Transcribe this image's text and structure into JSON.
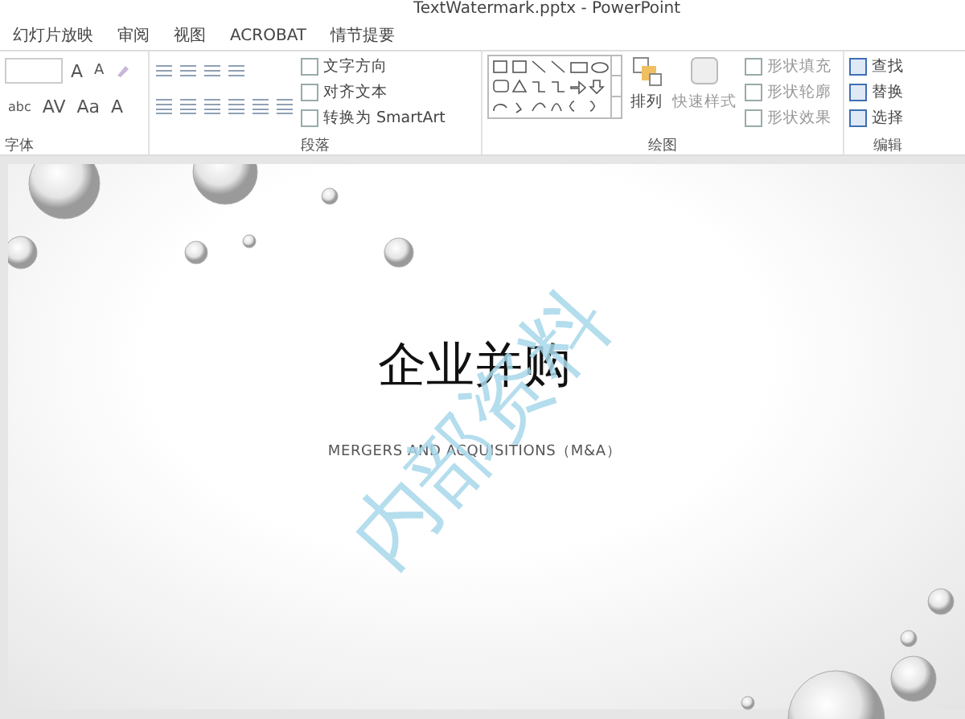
{
  "window": {
    "title": "TextWatermark.pptx - PowerPoint"
  },
  "tabs": [
    {
      "label": "幻灯片放映",
      "selected": false
    },
    {
      "label": "审阅",
      "selected": false
    },
    {
      "label": "视图",
      "selected": false
    },
    {
      "label": "ACROBAT",
      "selected": false
    },
    {
      "label": "情节提要",
      "selected": false
    }
  ],
  "font_group": {
    "label": "字体",
    "row1": [
      "A",
      "A"
    ],
    "row2": [
      "abc",
      "AV",
      "Aa",
      "A"
    ]
  },
  "paragraph_group": {
    "label": "段落",
    "commands": [
      "文字方向",
      "对齐文本",
      "转换为 SmartArt"
    ]
  },
  "drawing_group": {
    "label": "绘图",
    "arrange": "排列",
    "quick_styles": "快速样式",
    "commands": [
      "形状填充",
      "形状轮廓",
      "形状效果"
    ]
  },
  "editing_group": {
    "label": "编辑",
    "commands": [
      "查找",
      "替换",
      "选择"
    ]
  },
  "slide": {
    "title": "企业并购",
    "subtitle": "MERGERS AND ACQUISITIONS（M&A）",
    "watermark": "内部资料"
  }
}
